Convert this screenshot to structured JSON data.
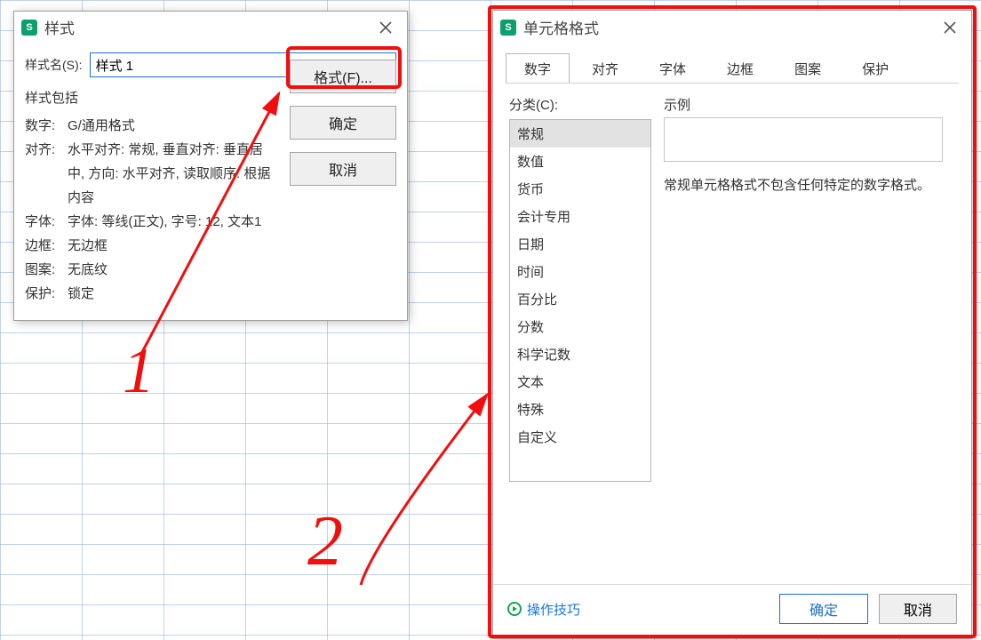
{
  "style_dialog": {
    "title": "样式",
    "name_label": "样式名(S):",
    "name_value": "样式 1",
    "includes_label": "样式包括",
    "rows": [
      {
        "key": "数字:",
        "val": "G/通用格式"
      },
      {
        "key": "对齐:",
        "val": "水平对齐: 常规, 垂直对齐: 垂直居中, 方向: 水平对齐, 读取顺序: 根据内容"
      },
      {
        "key": "字体:",
        "val": "字体: 等线(正文), 字号: 12, 文本1"
      },
      {
        "key": "边框:",
        "val": "无边框"
      },
      {
        "key": "图案:",
        "val": "无底纹"
      },
      {
        "key": "保护:",
        "val": "锁定"
      }
    ],
    "buttons": {
      "format": "格式(F)...",
      "ok": "确定",
      "cancel": "取消"
    }
  },
  "cell_format_dialog": {
    "title": "单元格格式",
    "tabs": [
      "数字",
      "对齐",
      "字体",
      "边框",
      "图案",
      "保护"
    ],
    "active_tab": 0,
    "category_label": "分类(C):",
    "categories": [
      "常规",
      "数值",
      "货币",
      "会计专用",
      "日期",
      "时间",
      "百分比",
      "分数",
      "科学记数",
      "文本",
      "特殊",
      "自定义"
    ],
    "selected_category": 0,
    "example_label": "示例",
    "description": "常规单元格格式不包含任何特定的数字格式。",
    "tips_link": "操作技巧",
    "ok": "确定",
    "cancel": "取消"
  },
  "annotations": {
    "one": "1",
    "two": "2"
  }
}
